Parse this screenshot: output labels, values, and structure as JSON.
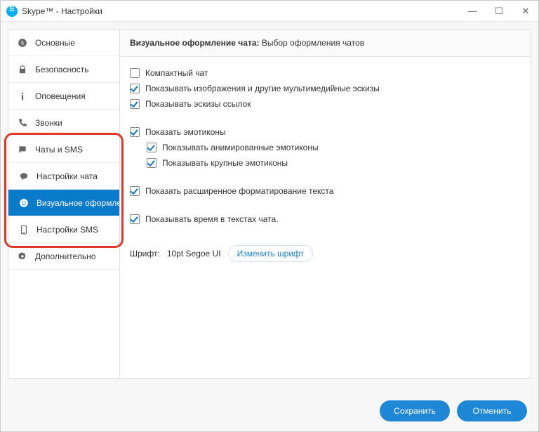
{
  "window": {
    "title": "Skype™ - Настройки"
  },
  "sidebar": {
    "items": [
      {
        "label": "Основные"
      },
      {
        "label": "Безопасность"
      },
      {
        "label": "Оповещения"
      },
      {
        "label": "Звонки"
      },
      {
        "label": "Чаты и SMS"
      },
      {
        "label": "Настройки чата"
      },
      {
        "label": "Визуальное оформле..."
      },
      {
        "label": "Настройки SMS"
      },
      {
        "label": "Дополнительно"
      }
    ]
  },
  "header": {
    "title_bold": "Визуальное оформление чата:",
    "title_rest": " Выбор оформления чатов"
  },
  "checks": {
    "compact": "Компактный чат",
    "images": "Показывать изображения и другие мультимедийные эскизы",
    "link_thumbs": "Показывать эскизы ссылок",
    "emoticons": "Показать эмотиконы",
    "anim_emoticons": "Показывать анимированные эмотиконы",
    "big_emoticons": "Показывать крупные эмотиконы",
    "rich_text": "Показать расширенное форматирование текста",
    "show_time": "Показывать время в текстах чата."
  },
  "font": {
    "label": "Шрифт:",
    "value": "10pt Segoe UI",
    "change": "Изменить шрифт"
  },
  "footer": {
    "save": "Сохранить",
    "cancel": "Отменить"
  }
}
